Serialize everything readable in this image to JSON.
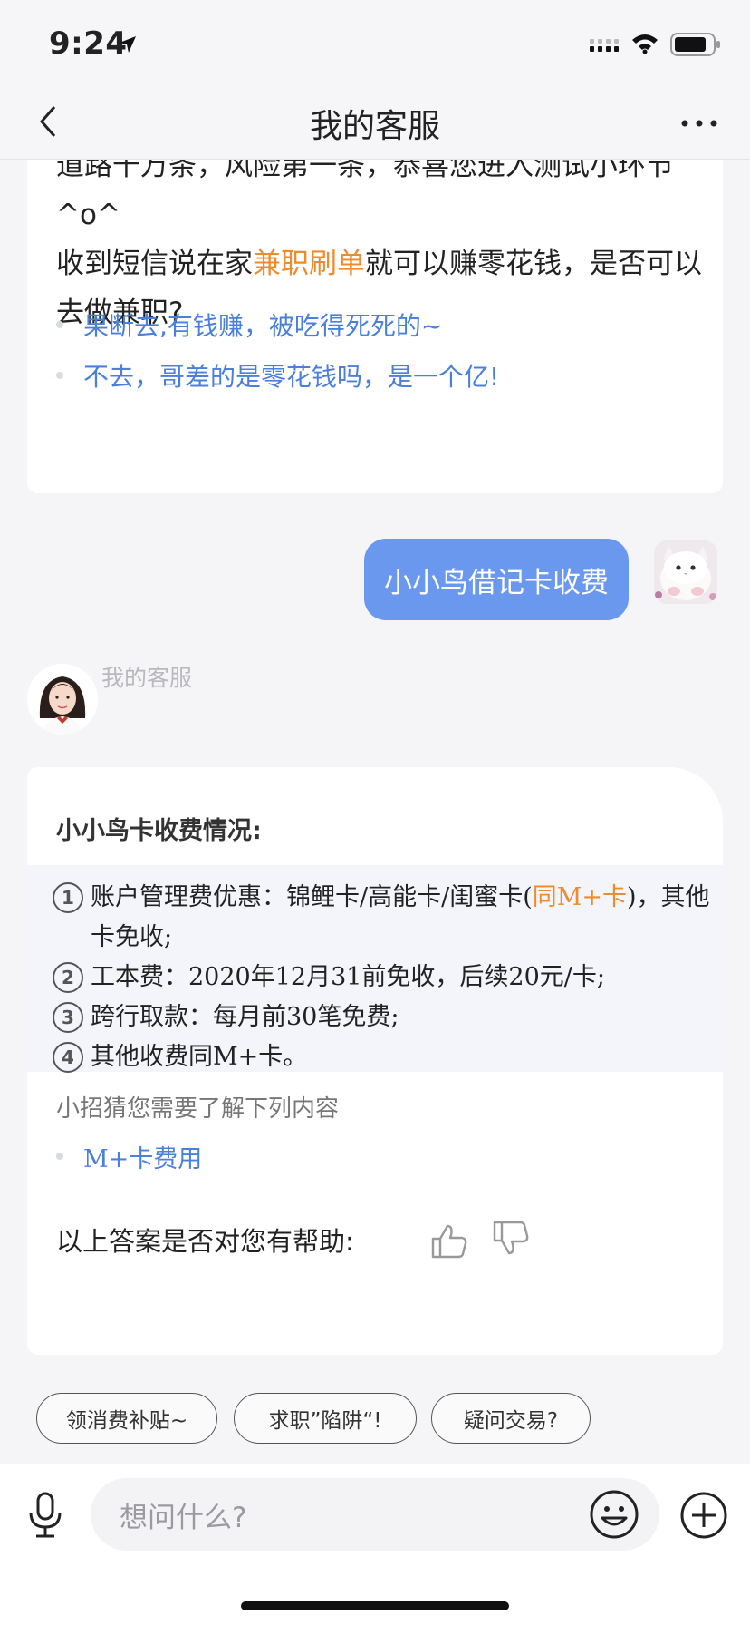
{
  "status": {
    "time": "9:24"
  },
  "nav": {
    "title": "我的客服",
    "back_icon": "chevron-left-icon",
    "more_icon": "more-dots-icon"
  },
  "card1": {
    "line1": "道路千万条，风险第一条，恭喜您进入测试小环节",
    "line2": "^o^",
    "question_pre": "收到短信说在家",
    "question_highlight": "兼职刷单",
    "question_post": "就可以赚零花钱，是否可以去做兼职?",
    "options": [
      "果断去,有钱赚，被吃得死死的~",
      "不去，哥差的是零花钱吗，是一个亿!"
    ]
  },
  "user_message": {
    "text": "小小鸟借记卡收费"
  },
  "agent": {
    "name": "我的客服"
  },
  "card2": {
    "title": "小小鸟卡收费情况:",
    "items": [
      {
        "num": "1",
        "pre": "账户管理费优惠：锦鲤卡/高能卡/闺蜜卡(",
        "highlight": "同M+卡",
        "post": ")，其他卡免收;"
      },
      {
        "num": "2",
        "text": "工本费：2020年12月31前免收，后续20元/卡;"
      },
      {
        "num": "3",
        "text": "跨行取款：每月前30笔免费;"
      },
      {
        "num": "4",
        "text": "其他收费同M+卡。"
      }
    ],
    "hint_title": "小招猜您需要了解下列内容",
    "hint_link": "M+卡费用",
    "feedback_prompt": "以上答案是否对您有帮助:"
  },
  "quick_replies": [
    "领消费补贴~",
    "求职”陷阱“!",
    "疑问交易?"
  ],
  "input": {
    "placeholder": "想问什么?"
  },
  "colors": {
    "accent_blue": "#6b98ef",
    "link_blue": "#4b7fdc",
    "highlight_orange": "#f08a2b"
  }
}
